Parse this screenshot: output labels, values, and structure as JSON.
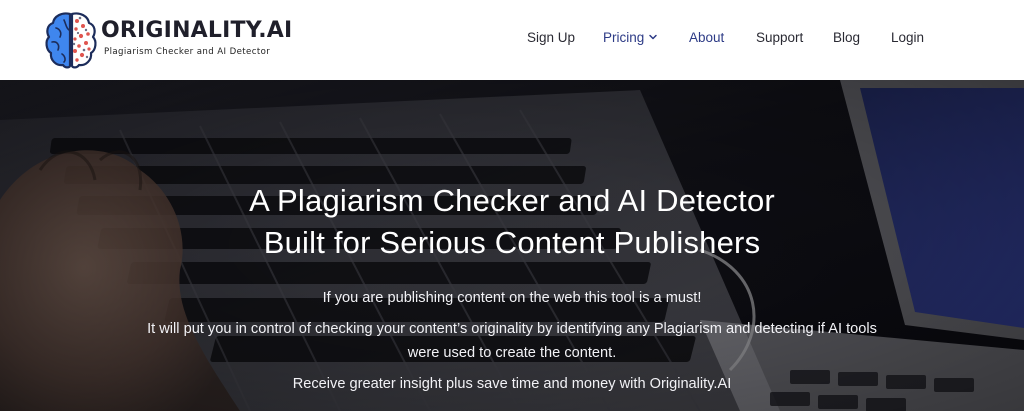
{
  "header": {
    "logo": {
      "title": "ORIGINALITY.AI",
      "subtitle": "Plagiarism Checker and AI Detector",
      "icon": "brain-logo-icon"
    },
    "nav": [
      {
        "label": "Sign Up"
      },
      {
        "label": "Pricing",
        "icon": "chevron-down-icon"
      },
      {
        "label": "About"
      },
      {
        "label": "Support"
      },
      {
        "label": "Blog"
      },
      {
        "label": "Login"
      }
    ]
  },
  "hero": {
    "title_line1": "A Plagiarism Checker and AI Detector",
    "title_line2": "Built for Serious Content Publishers",
    "para1": "If you are publishing content on the web this tool is a must!",
    "para2_line1": "It will put you in control of checking your content’s originality by identifying any Plagiarism and detecting if AI tools",
    "para2_line2": "were used to create the content.",
    "para3": "Receive greater insight plus save time and money with Originality.AI",
    "background": "laptop-keyboard-photo"
  },
  "colors": {
    "nav_accent": "#2d3b86",
    "brain_blue": "#3f86ee",
    "brain_red": "#e0554f",
    "hero_text": "#ffffff"
  }
}
